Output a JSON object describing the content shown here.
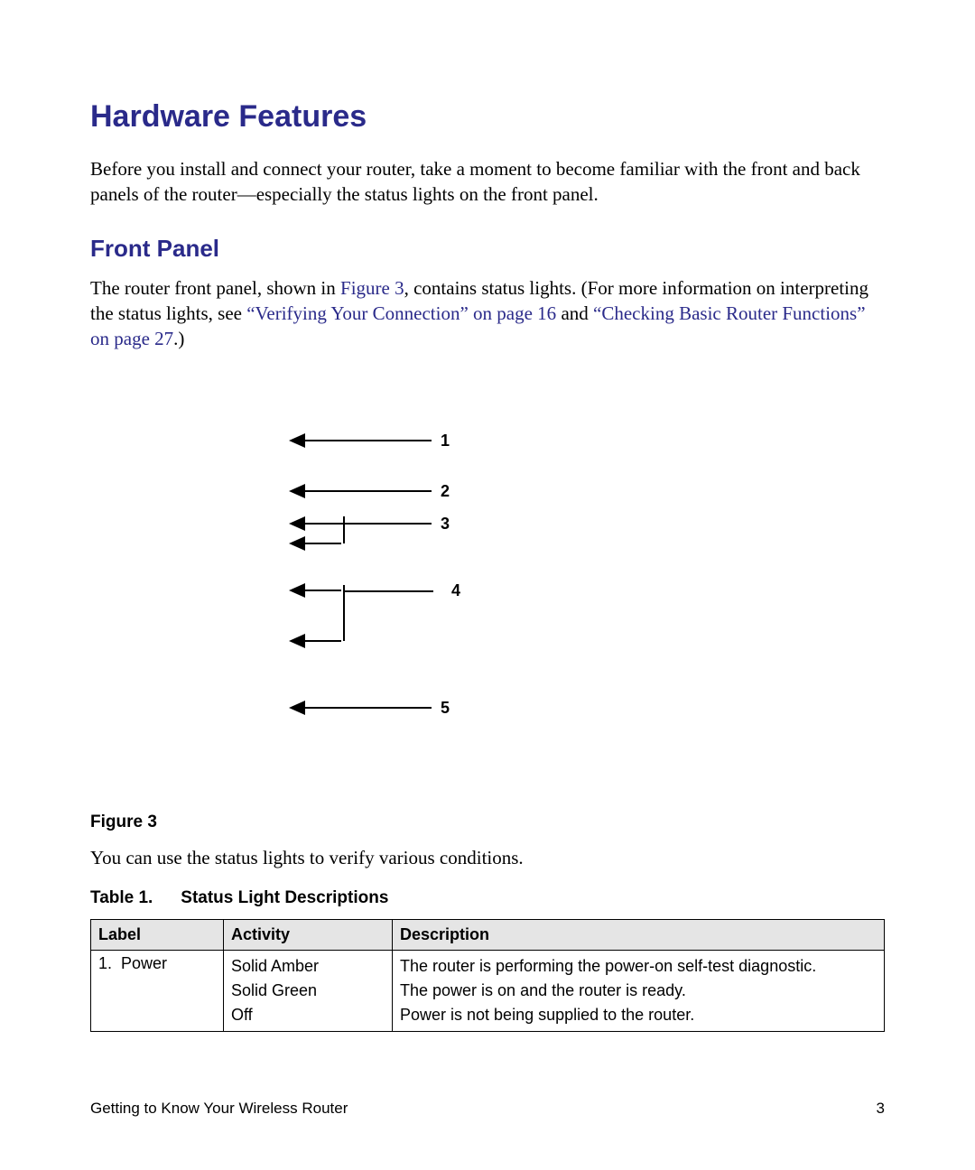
{
  "headings": {
    "h1": "Hardware Features",
    "h2": "Front Panel"
  },
  "paragraphs": {
    "intro": "Before you install and connect your router, take a moment to become familiar with the front and back panels of the router—especially the status lights on the front panel.",
    "front_a": "The router front panel, shown in ",
    "front_link1": "Figure 3",
    "front_b": ", contains status lights. (For more information on interpreting the status lights, see ",
    "front_link2": "“Verifying Your Connection” on page 16",
    "front_c": " and ",
    "front_link3": "“Checking Basic Router Functions” on page 27",
    "front_d": ".)",
    "post_figure": "You can use the status lights to verify various conditions."
  },
  "figure": {
    "caption": "Figure 3",
    "callouts": {
      "c1": "1",
      "c2": "2",
      "c3": "3",
      "c4": "4",
      "c5": "5"
    }
  },
  "table": {
    "title_num": "Table 1.",
    "title_text": "Status Light Descriptions",
    "headers": {
      "label": "Label",
      "activity": "Activity",
      "description": "Description"
    },
    "rows": [
      {
        "num": "1.",
        "label": "Power",
        "activity": [
          "Solid Amber",
          "Solid Green",
          "Off"
        ],
        "description": [
          "The router is performing the power-on self-test diagnostic.",
          "The power is on and the router is ready.",
          "Power is not being supplied to the router."
        ]
      }
    ]
  },
  "footer": {
    "left": "Getting to Know Your Wireless Router",
    "right": "3"
  }
}
